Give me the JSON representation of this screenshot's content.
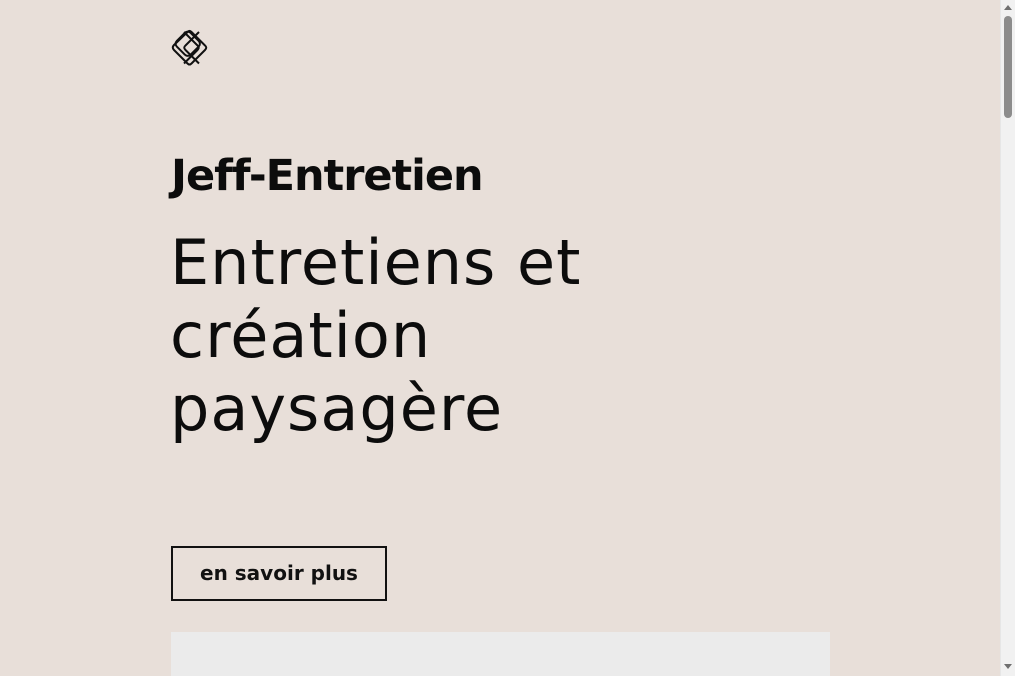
{
  "brand": {
    "logo_icon": "interlocked-diamond-logo-icon",
    "name": "Jeff-Entretien"
  },
  "hero": {
    "headline_lines": [
      "Entretiens et",
      "création",
      "paysagère"
    ],
    "cta_label": "en savoir plus"
  },
  "colors": {
    "background": "#e8dfd9",
    "text": "#0c0c0c",
    "panel": "#ebebeb"
  }
}
